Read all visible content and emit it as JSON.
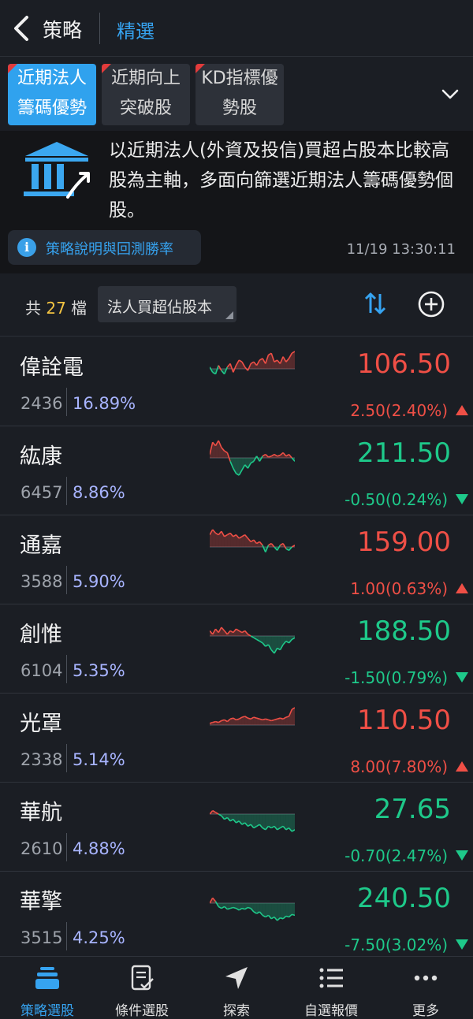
{
  "header": {
    "title": "策略",
    "tab": "精選"
  },
  "chips": [
    {
      "line1": "近期法人",
      "line2": "籌碼優勢",
      "active": true
    },
    {
      "line1": "近期向上",
      "line2": "突破股",
      "active": false
    },
    {
      "line1": "KD指標優",
      "line2": "勢股",
      "active": false
    }
  ],
  "description": {
    "text": "以近期法人(外資及投信)買超占股本比較高股為主軸，多面向篩選近期法人籌碼優勢個股。",
    "info_label": "策略說明與回測勝率",
    "timestamp": "11/19 13:30:11"
  },
  "count": {
    "prefix": "共",
    "number": "27",
    "suffix": "檔"
  },
  "sort": {
    "label": "法人買超佔股本"
  },
  "stocks": [
    {
      "name": "偉詮電",
      "code": "2436",
      "pct": "16.89%",
      "price": "106.50",
      "change": "2.50(2.40%)",
      "dir": "up",
      "spark": [
        0.1,
        -0.2,
        -0.3,
        0.2,
        -0.1,
        -0.3,
        0.1,
        0.3,
        -0.2,
        0.2,
        0.5,
        0.4,
        0.1,
        -0.1,
        0.3,
        0.4,
        0.2,
        0.5,
        0.6,
        0.3,
        0.8,
        0.9,
        0.4,
        0.5,
        0.3,
        0.7,
        0.4,
        0.6,
        0.9,
        1.0
      ]
    },
    {
      "name": "紘康",
      "code": "6457",
      "pct": "8.86%",
      "price": "211.50",
      "change": "-0.50(0.24%)",
      "dir": "down",
      "spark": [
        0.2,
        0.9,
        0.7,
        1.0,
        0.6,
        0.4,
        0.3,
        -0.2,
        -0.6,
        -0.9,
        -1.0,
        -0.7,
        -0.4,
        -0.6,
        -0.3,
        -0.2,
        0.1,
        -0.2,
        0.1,
        0.2,
        0.05,
        0.1,
        0.2,
        0.1,
        0.15,
        0.3,
        0.1,
        0.2,
        0.0,
        -0.2
      ]
    },
    {
      "name": "通嘉",
      "code": "3588",
      "pct": "5.90%",
      "price": "159.00",
      "change": "1.00(0.63%)",
      "dir": "up",
      "spark": [
        0.7,
        1.0,
        0.8,
        0.7,
        0.9,
        0.6,
        0.7,
        0.8,
        0.6,
        0.7,
        0.5,
        0.6,
        0.7,
        0.5,
        0.3,
        0.4,
        0.2,
        0.3,
        0.1,
        -0.3,
        0.1,
        0.2,
        0.0,
        -0.2,
        0.1,
        0.2,
        -0.1,
        -0.2,
        0.0,
        0.1
      ]
    },
    {
      "name": "創惟",
      "code": "6104",
      "pct": "5.35%",
      "price": "188.50",
      "change": "-1.50(0.79%)",
      "dir": "down",
      "spark": [
        0.3,
        0.1,
        0.4,
        0.2,
        0.5,
        0.3,
        0.1,
        0.3,
        0.2,
        0.4,
        0.3,
        0.2,
        0.3,
        0.1,
        0.0,
        -0.1,
        -0.2,
        -0.3,
        -0.4,
        -0.6,
        -0.5,
        -0.8,
        -1.0,
        -0.7,
        -0.8,
        -0.5,
        -0.3,
        -0.4,
        -0.2,
        -0.1
      ]
    },
    {
      "name": "光罩",
      "code": "2338",
      "pct": "5.14%",
      "price": "110.50",
      "change": "8.00(7.80%)",
      "dir": "up",
      "spark": [
        0.1,
        0.15,
        0.2,
        0.15,
        0.25,
        0.3,
        0.2,
        0.35,
        0.4,
        0.3,
        0.35,
        0.45,
        0.5,
        0.4,
        0.35,
        0.45,
        0.4,
        0.35,
        0.3,
        0.35,
        0.3,
        0.25,
        0.3,
        0.35,
        0.4,
        0.35,
        0.45,
        0.5,
        0.9,
        1.0
      ]
    },
    {
      "name": "華航",
      "code": "2610",
      "pct": "4.88%",
      "price": "27.65",
      "change": "-0.70(2.47%)",
      "dir": "down",
      "spark": [
        0.0,
        0.2,
        0.1,
        0.0,
        -0.1,
        -0.3,
        -0.2,
        -0.4,
        -0.3,
        -0.5,
        -0.4,
        -0.6,
        -0.5,
        -0.7,
        -0.6,
        -0.8,
        -0.7,
        -0.6,
        -0.8,
        -0.9,
        -0.7,
        -0.8,
        -0.7,
        -0.9,
        -0.8,
        -0.7,
        -0.9,
        -0.8,
        -1.0,
        -0.9
      ]
    },
    {
      "name": "華擎",
      "code": "3515",
      "pct": "4.25%",
      "price": "240.50",
      "change": "-7.50(3.02%)",
      "dir": "down",
      "spark": [
        0.0,
        0.3,
        0.1,
        -0.2,
        -0.3,
        -0.2,
        -0.35,
        -0.3,
        -0.25,
        -0.3,
        -0.4,
        -0.3,
        -0.35,
        -0.25,
        -0.3,
        -0.5,
        -0.6,
        -0.5,
        -0.7,
        -0.8,
        -0.7,
        -0.9,
        -0.8,
        -1.0,
        -0.85,
        -0.9,
        -0.75,
        -0.8,
        -0.65,
        -0.7
      ]
    }
  ],
  "nav": [
    {
      "label": "策略選股",
      "icon": "stack-icon",
      "active": true
    },
    {
      "label": "條件選股",
      "icon": "checklist-icon",
      "active": false
    },
    {
      "label": "探索",
      "icon": "navigation-arrow-icon",
      "active": false
    },
    {
      "label": "自選報價",
      "icon": "list-icon",
      "active": false
    },
    {
      "label": "更多",
      "icon": "more-icon",
      "active": false
    }
  ],
  "colors": {
    "up": "#ef4f46",
    "down": "#1ec98a",
    "accent": "#36a3f0",
    "background": "#1b1e24"
  }
}
